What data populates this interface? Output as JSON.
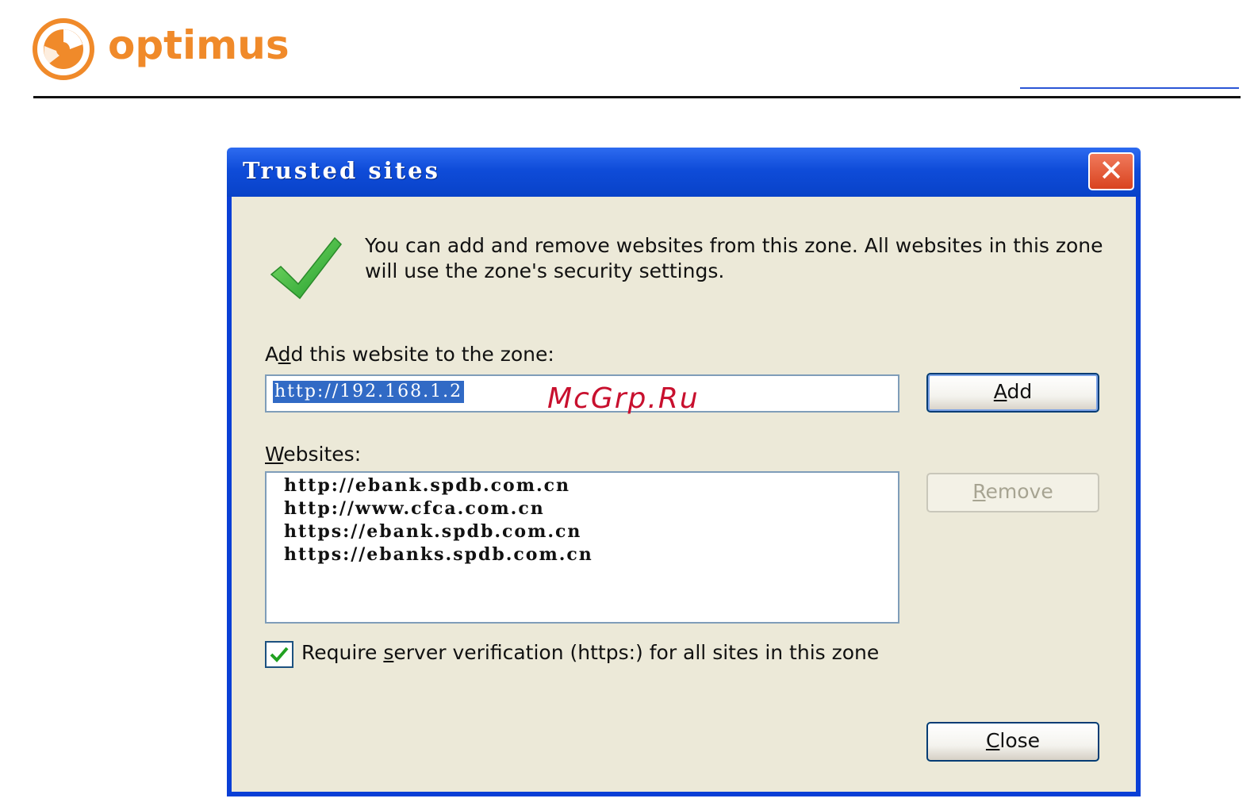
{
  "header": {
    "brand": "optimus",
    "brand_color": "#f08a2a"
  },
  "dialog": {
    "title": "Trusted sites",
    "close_symbol": "✕",
    "info_text": "You can add and remove websites from this zone. All websites in this zone will use the zone's security settings.",
    "add_label_prefix": "A",
    "add_label_accel": "d",
    "add_label_rest": "d this website to the zone:",
    "url_value": "http://192.168.1.2",
    "add_button_accel": "A",
    "add_button_rest": "dd",
    "websites_label_accel": "W",
    "websites_label_rest": "ebsites:",
    "websites": [
      "http://ebank.spdb.com.cn",
      "http://www.cfca.com.cn",
      "https://ebank.spdb.com.cn",
      "https://ebanks.spdb.com.cn"
    ],
    "remove_button_accel": "R",
    "remove_button_rest": "emove",
    "verify_checked": true,
    "verify_prefix": "Require ",
    "verify_accel": "s",
    "verify_rest": "erver verification (https:) for all sites in this zone",
    "close_button_accel": "C",
    "close_button_rest": "lose"
  },
  "watermark": "McGrp.Ru",
  "icons": {
    "logo": "optimus-logo-icon",
    "check": "green-checkmark-icon",
    "close": "close-icon"
  },
  "colors": {
    "titlebar": "#0f4cd9",
    "client": "#ece9d8",
    "selection": "#316ac5",
    "close_button": "#d9431f",
    "watermark": "#c8102e"
  }
}
